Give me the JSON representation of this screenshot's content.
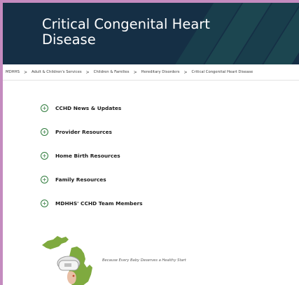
{
  "hero": {
    "title": "Critical Congenital Heart Disease"
  },
  "breadcrumb": [
    "MDHHS",
    "Adult & Children's Services",
    "Children & Families",
    "Hereditary Disorders",
    "Critical Congenital Heart Disease"
  ],
  "breadcrumb_separator": ">",
  "accordion": [
    {
      "label": "CCHD News & Updates",
      "icon": "plus-circle-icon"
    },
    {
      "label": "Provider Resources",
      "icon": "plus-circle-icon"
    },
    {
      "label": "Home Birth Resources",
      "icon": "plus-circle-icon"
    },
    {
      "label": "Family Resources",
      "icon": "plus-circle-icon"
    },
    {
      "label": "MDHHS' CCHD Team Members",
      "icon": "plus-circle-icon"
    }
  ],
  "logo": {
    "tagline": "Because Every Baby Deserves a Healthy Start"
  },
  "colors": {
    "hero_bg": "#152f45",
    "accent_green": "#2f7b3c",
    "frame": "#c48bbf"
  }
}
